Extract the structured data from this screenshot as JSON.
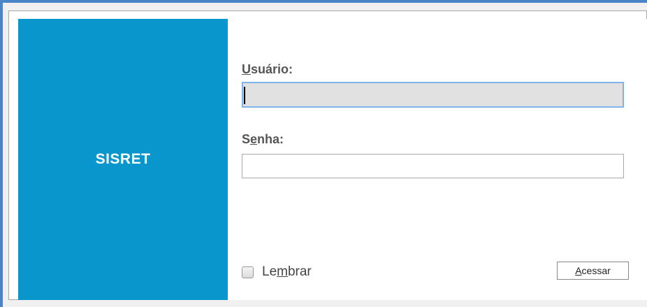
{
  "brand": {
    "title": "SISRET"
  },
  "login_form": {
    "username": {
      "label_first": "U",
      "label_rest": "suário:",
      "value": ""
    },
    "password": {
      "label_first": "S",
      "label_mnemonic": "e",
      "label_rest": "nha:",
      "value": ""
    },
    "remember": {
      "label_first": "Le",
      "label_mnemonic": "m",
      "label_rest": "brar",
      "checked": false
    },
    "submit": {
      "label_mnemonic": "A",
      "label_rest": "cessar"
    }
  },
  "colors": {
    "brand_panel": "#0896cd",
    "window_border": "#4a84c9",
    "focus_border": "#7eb4ea",
    "focused_field_bg": "#e1e1e1"
  }
}
